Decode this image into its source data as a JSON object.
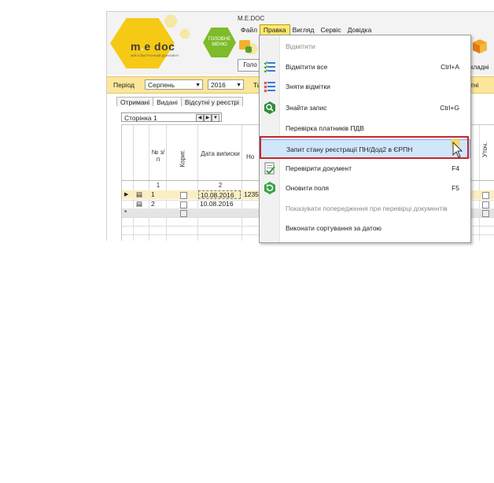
{
  "app": {
    "window_title": "M.E.DOC",
    "logo_text_a": "m",
    "logo_text_b": "e",
    "logo_text_c": "doc",
    "logo_sub": "МІЙ ЕЛЕКТРОННИЙ ДОКУМЕНТ",
    "main_menu_button": "ГОЛОВНЕ МЕНЮ"
  },
  "menubar": {
    "items": [
      "Файл",
      "Правка",
      "Вигляд",
      "Сервіс",
      "Довідка"
    ],
    "active": "Правка"
  },
  "toolbar": {
    "golov_label": "Голо",
    "right_partial": "кладні"
  },
  "period_bar": {
    "label": "Період",
    "month": "Серпень",
    "year": "2016",
    "type_partial": "Ти",
    "right_partial": "тні"
  },
  "tabs": [
    "Отримані",
    "Видані",
    "Відсутні у реєстрі"
  ],
  "selected_tab": "Видані",
  "pager": {
    "label": "Сторінка 1"
  },
  "grid": {
    "headers": {
      "num": "№ з/п",
      "korig": "Кориг.",
      "date": "Дата виписки",
      "no_partial": "Но",
      "utoch": "Уточ."
    },
    "col_numbers": {
      "num": "1",
      "date": "2"
    },
    "rows": [
      {
        "num": "1",
        "date": "10.08.2016",
        "no": "12358",
        "selected": true
      },
      {
        "num": "2",
        "date": "10.08.2016",
        "no": "",
        "selected": false
      }
    ],
    "new_row_marker": "*"
  },
  "dropdown": {
    "items": [
      {
        "label": "Відмітити",
        "shortcut": "",
        "disabled": true,
        "icon": ""
      },
      {
        "label": "Відмітити все",
        "shortcut": "Ctrl+A",
        "disabled": false,
        "icon": "check-all-icon"
      },
      {
        "label": "Зняти відмітки",
        "shortcut": "",
        "disabled": false,
        "icon": "uncheck-icon"
      },
      {
        "label": "Знайти запис",
        "shortcut": "Ctrl+G",
        "disabled": false,
        "icon": "find-icon"
      },
      {
        "label": "Перевірка платників ПДВ",
        "shortcut": "",
        "disabled": false,
        "icon": ""
      },
      {
        "label": "Запит стану реєстрації ПН/Дод2 в ЄРПН",
        "shortcut": "",
        "disabled": false,
        "icon": "",
        "highlighted": true
      },
      {
        "label": "Перевірити документ",
        "shortcut": "F4",
        "disabled": false,
        "icon": "check-doc-icon"
      },
      {
        "label": "Оновити поля",
        "shortcut": "F5",
        "disabled": false,
        "icon": "refresh-icon"
      },
      {
        "label": "Показувати попередження при перевірці документів",
        "shortcut": "",
        "disabled": true,
        "icon": ""
      },
      {
        "label": "Виконати сортування за датою",
        "shortcut": "",
        "disabled": false,
        "icon": ""
      }
    ]
  },
  "colors": {
    "accent_yellow": "#f6c915",
    "period_bar": "#fbe69a",
    "green": "#7dbb2a",
    "highlight_frame": "#c6262e",
    "highlight_fill": "#cfe6fb"
  }
}
